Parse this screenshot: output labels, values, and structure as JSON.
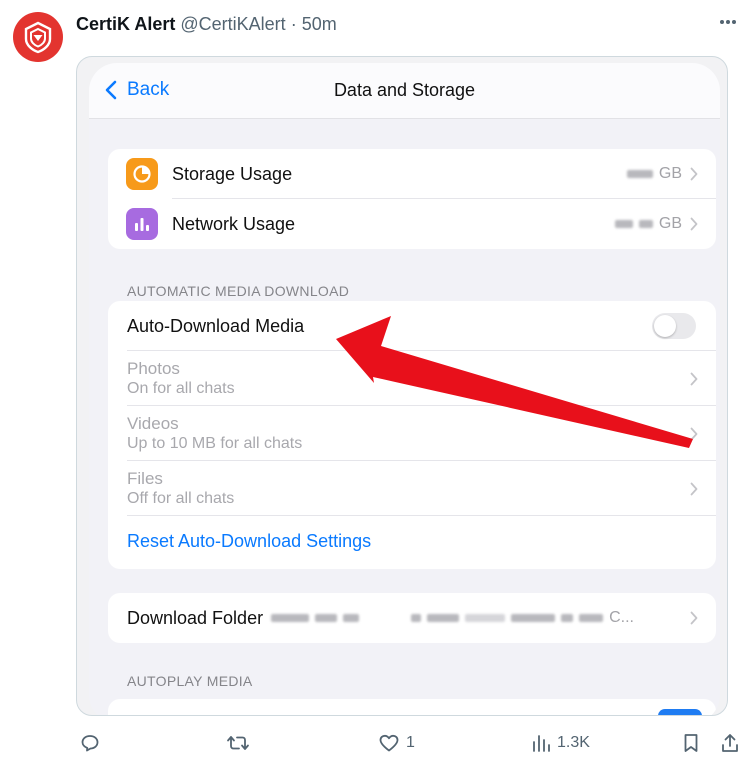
{
  "tweet": {
    "author_name": "CertiK Alert",
    "handle": "@CertiKAlert",
    "separator": "·",
    "time": "50m",
    "more_icon": "ellipsis-icon",
    "avatar_icon": "certik-shield-logo"
  },
  "settings": {
    "back_label": "Back",
    "title": "Data and Storage",
    "usage_rows": [
      {
        "label": "Storage Usage",
        "value_suffix": "GB",
        "icon": "pie-chart-icon",
        "icon_color": "#f79a1a"
      },
      {
        "label": "Network Usage",
        "value_suffix": "GB",
        "icon": "bar-chart-icon",
        "icon_color": "#a76be0"
      }
    ],
    "auto_section_header": "AUTOMATIC MEDIA DOWNLOAD",
    "auto_download_label": "Auto-Download Media",
    "auto_download_enabled": false,
    "media_rows": [
      {
        "title": "Photos",
        "desc": "On for all chats"
      },
      {
        "title": "Videos",
        "desc": "Up to 10 MB for all chats"
      },
      {
        "title": "Files",
        "desc": "Off for all chats"
      }
    ],
    "reset_label": "Reset Auto-Download Settings",
    "download_folder_label": "Download Folder",
    "download_folder_suffix": "C...",
    "autoplay_section_header": "AUTOPLAY MEDIA",
    "accent_color": "#0a7aff",
    "annotation_arrow_color": "#e8101b"
  },
  "actions": {
    "reply_icon": "reply-icon",
    "retweet_icon": "retweet-icon",
    "like_icon": "heart-icon",
    "like_count": "1",
    "views_icon": "views-icon",
    "views_count": "1.3K",
    "bookmark_icon": "bookmark-icon",
    "share_icon": "share-icon"
  }
}
